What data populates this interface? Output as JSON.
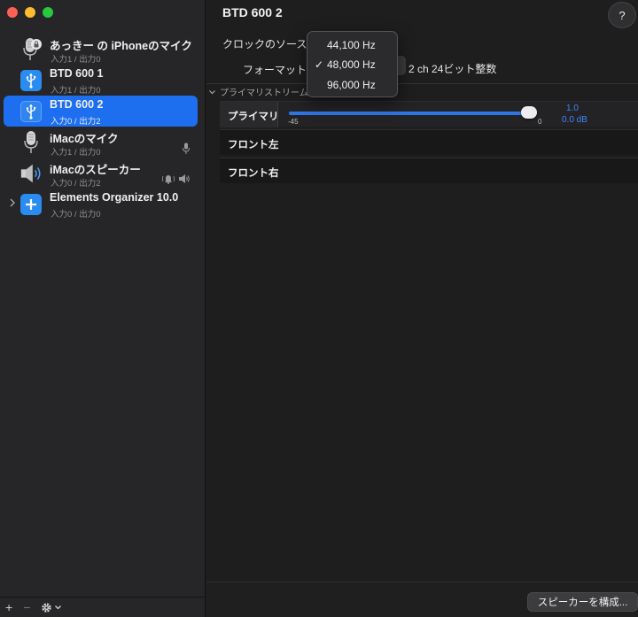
{
  "sidebar": {
    "devices": [
      {
        "name": "あっきー の iPhoneのマイク",
        "io": "入力1 / 出力0",
        "icon": "microphone-lock-icon",
        "selected": false
      },
      {
        "name": "BTD 600 1",
        "io": "入力1 / 出力0",
        "icon": "usb-icon",
        "selected": false
      },
      {
        "name": "BTD 600 2",
        "io": "入力0 / 出力2",
        "icon": "usb-icon",
        "selected": true
      },
      {
        "name": "iMacのマイク",
        "io": "入力1 / 出力0",
        "icon": "microphone-icon",
        "selected": false
      },
      {
        "name": "iMacのスピーカー",
        "io": "入力0 / 出力2",
        "icon": "speaker-icon",
        "selected": false
      },
      {
        "name": "Elements Organizer 10.0",
        "io": "入力0 / 出力0",
        "icon": "plus-icon",
        "selected": false
      }
    ],
    "bottom": {
      "add": "+",
      "remove": "−"
    }
  },
  "main": {
    "title": "BTD 600 2",
    "help": "?",
    "clock_source_label": "クロックのソース:",
    "format_label": "フォーマット:",
    "format_value": "2 ch 24ビット整数",
    "section_title": "プライマリストリーム",
    "streams": [
      {
        "label": "プライマリ",
        "has_slider": true
      },
      {
        "label": "フロント左",
        "has_slider": false
      },
      {
        "label": "フロント右",
        "has_slider": false
      }
    ],
    "slider": {
      "min_label": "-45",
      "max_label": "0",
      "value": "1.0",
      "db": "0.0 dB",
      "level_fraction": 1.0
    },
    "configure_button": "スピーカーを構成..."
  },
  "popup": {
    "items": [
      {
        "label": "44,100 Hz",
        "checked": false
      },
      {
        "label": "48,000 Hz",
        "checked": true
      },
      {
        "label": "96,000 Hz",
        "checked": false
      }
    ],
    "check_glyph": "✓"
  },
  "colors": {
    "accent": "#1d6ff0",
    "slider_blue": "#2e76e6",
    "value_blue": "#3f86f7"
  }
}
